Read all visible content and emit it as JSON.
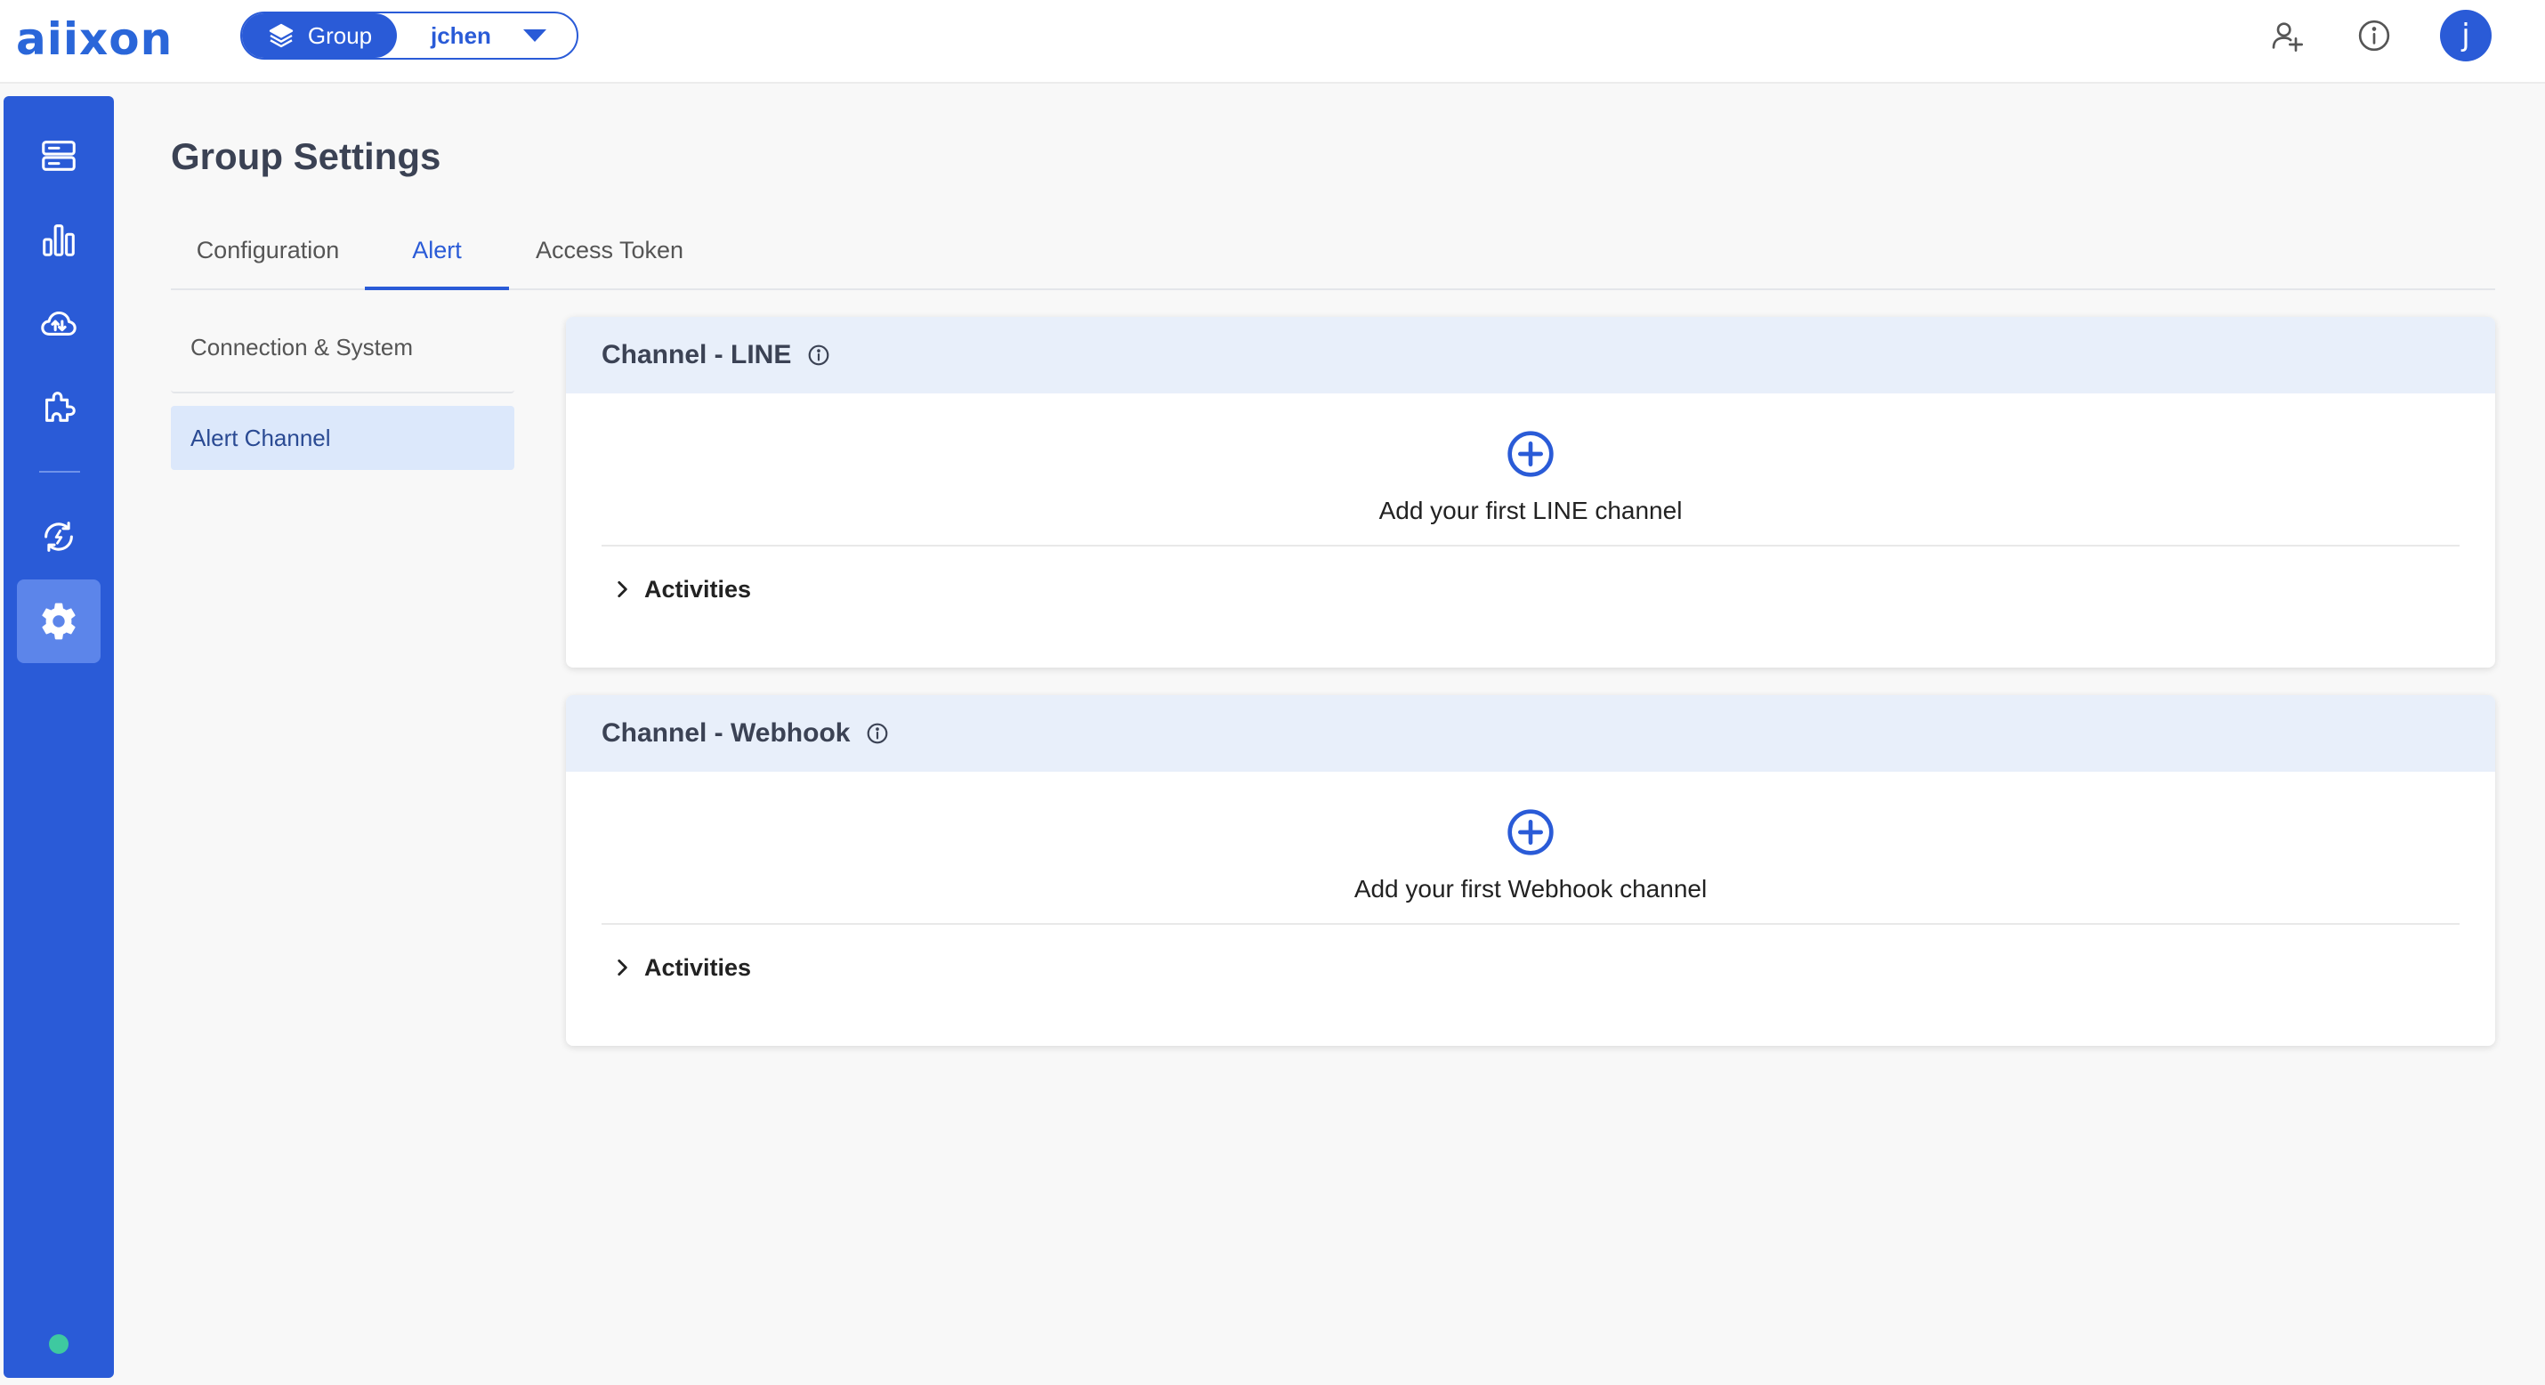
{
  "topbar": {
    "logo": "aiixon",
    "group_label": "Group",
    "group_user": "jchen",
    "avatar_initial": "j"
  },
  "page": {
    "title": "Group Settings"
  },
  "tabs": [
    {
      "label": "Configuration",
      "active": false
    },
    {
      "label": "Alert",
      "active": true
    },
    {
      "label": "Access Token",
      "active": false
    }
  ],
  "subnav": [
    {
      "label": "Connection & System",
      "active": false
    },
    {
      "label": "Alert Channel",
      "active": true
    }
  ],
  "cards": [
    {
      "title": "Channel - LINE",
      "add_text": "Add your first LINE channel",
      "activities": "Activities"
    },
    {
      "title": "Channel - Webhook",
      "add_text": "Add your first Webhook channel",
      "activities": "Activities"
    }
  ],
  "colors": {
    "brand": "#2a5bd7",
    "status": "#3ec9a0"
  }
}
